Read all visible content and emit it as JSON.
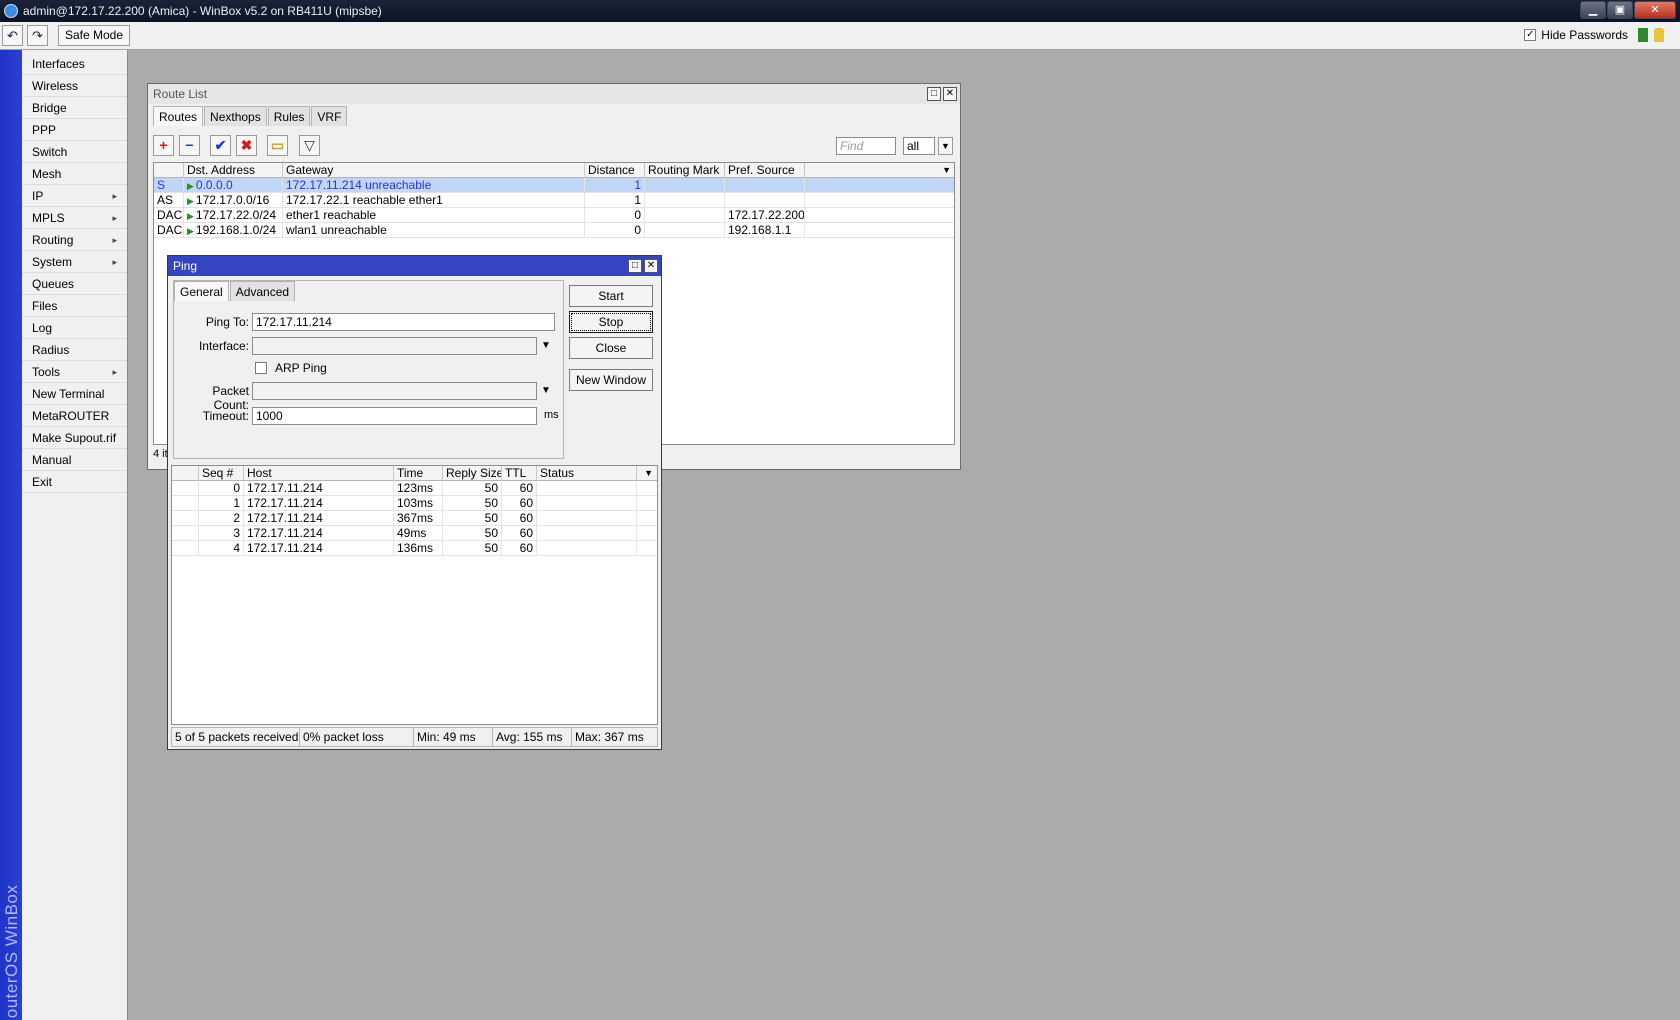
{
  "window_title": "admin@172.17.22.200 (Amica) - WinBox v5.2 on RB411U (mipsbe)",
  "window_controls": {
    "minimize": "▁",
    "maximize": "▣",
    "close": "✕"
  },
  "toolbar": {
    "undo_icon": "undo-icon",
    "redo_icon": "redo-icon",
    "safe_mode": "Safe Mode",
    "hide_passwords": "Hide Passwords",
    "hide_passwords_checked": true
  },
  "sidebar": {
    "brand": "RouterOS WinBox",
    "items": [
      {
        "label": "Interfaces",
        "submenu": false
      },
      {
        "label": "Wireless",
        "submenu": false
      },
      {
        "label": "Bridge",
        "submenu": false
      },
      {
        "label": "PPP",
        "submenu": false
      },
      {
        "label": "Switch",
        "submenu": false
      },
      {
        "label": "Mesh",
        "submenu": false
      },
      {
        "label": "IP",
        "submenu": true
      },
      {
        "label": "MPLS",
        "submenu": true
      },
      {
        "label": "Routing",
        "submenu": true
      },
      {
        "label": "System",
        "submenu": true
      },
      {
        "label": "Queues",
        "submenu": false
      },
      {
        "label": "Files",
        "submenu": false
      },
      {
        "label": "Log",
        "submenu": false
      },
      {
        "label": "Radius",
        "submenu": false
      },
      {
        "label": "Tools",
        "submenu": true
      },
      {
        "label": "New Terminal",
        "submenu": false
      },
      {
        "label": "MetaROUTER",
        "submenu": false
      },
      {
        "label": "Make Supout.rif",
        "submenu": false
      },
      {
        "label": "Manual",
        "submenu": false
      },
      {
        "label": "Exit",
        "submenu": false
      }
    ]
  },
  "route_list": {
    "title": "Route List",
    "tabs": [
      "Routes",
      "Nexthops",
      "Rules",
      "VRF"
    ],
    "active_tab": "Routes",
    "find_placeholder": "Find",
    "filter_value": "all",
    "columns": [
      "",
      "Dst. Address",
      "Gateway",
      "Distance",
      "Routing Mark",
      "Pref. Source"
    ],
    "rows": [
      {
        "flags": "S",
        "dst": "0.0.0.0",
        "gateway": "172.17.11.214 unreachable",
        "distance": "1",
        "mark": "",
        "pref": "",
        "selected": true
      },
      {
        "flags": "AS",
        "dst": "172.17.0.0/16",
        "gateway": "172.17.22.1 reachable ether1",
        "distance": "1",
        "mark": "",
        "pref": "",
        "selected": false
      },
      {
        "flags": "DAC",
        "dst": "172.17.22.0/24",
        "gateway": "ether1 reachable",
        "distance": "0",
        "mark": "",
        "pref": "172.17.22.200",
        "selected": false
      },
      {
        "flags": "DAC",
        "dst": "192.168.1.0/24",
        "gateway": "wlan1 unreachable",
        "distance": "0",
        "mark": "",
        "pref": "192.168.1.1",
        "selected": false
      }
    ],
    "status": "4 it"
  },
  "ping": {
    "title": "Ping",
    "tabs": [
      "General",
      "Advanced"
    ],
    "active_tab": "General",
    "ping_to_label": "Ping To:",
    "ping_to_value": "172.17.11.214",
    "interface_label": "Interface:",
    "interface_value": "",
    "arp_ping_label": "ARP Ping",
    "arp_ping_checked": false,
    "packet_count_label": "Packet Count:",
    "packet_count_value": "",
    "timeout_label": "Timeout:",
    "timeout_value": "1000",
    "timeout_unit": "ms",
    "buttons": {
      "start": "Start",
      "stop": "Stop",
      "close": "Close",
      "new_window": "New Window"
    },
    "columns": [
      "",
      "Seq #",
      "Host",
      "Time",
      "Reply Size",
      "TTL",
      "Status"
    ],
    "results": [
      {
        "seq": "0",
        "host": "172.17.11.214",
        "time": "123ms",
        "size": "50",
        "ttl": "60",
        "status": ""
      },
      {
        "seq": "1",
        "host": "172.17.11.214",
        "time": "103ms",
        "size": "50",
        "ttl": "60",
        "status": ""
      },
      {
        "seq": "2",
        "host": "172.17.11.214",
        "time": "367ms",
        "size": "50",
        "ttl": "60",
        "status": ""
      },
      {
        "seq": "3",
        "host": "172.17.11.214",
        "time": "49ms",
        "size": "50",
        "ttl": "60",
        "status": ""
      },
      {
        "seq": "4",
        "host": "172.17.11.214",
        "time": "136ms",
        "size": "50",
        "ttl": "60",
        "status": ""
      }
    ],
    "status": {
      "received": "5 of 5 packets received",
      "loss": "0% packet loss",
      "min": "Min: 49 ms",
      "avg": "Avg: 155 ms",
      "max": "Max: 367 ms"
    }
  },
  "colors": {
    "sidebar_strip": "#2235c8",
    "selected_row": "#c0d6f4",
    "selected_text": "#2a33d8",
    "desktop": "#ababab",
    "ping_titlebar": "#3545c2"
  }
}
